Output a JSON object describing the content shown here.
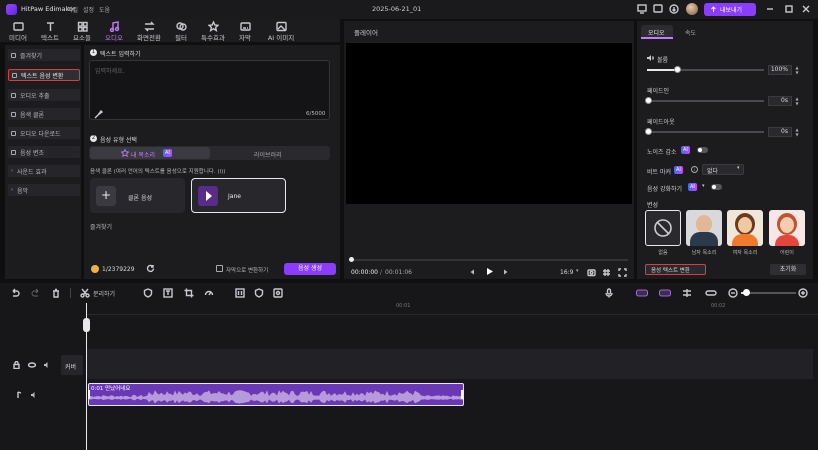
{
  "window": {
    "app_name": "HitPaw Edimakor",
    "menus": [
      "파일",
      "설정",
      "도움"
    ],
    "project_title": "2025-06-21_01",
    "export_label": "내보내기"
  },
  "toolbar": {
    "tools": [
      "미디어",
      "텍스트",
      "요소들",
      "오디오",
      "화면전환",
      "필터",
      "특수효과",
      "자막",
      "AI 이미지"
    ],
    "active_tool": "오디오"
  },
  "left_nav": {
    "items": [
      "즐겨찾기",
      "텍스트 음성 변환",
      "오디오 추출",
      "음색 클론",
      "오디오 다운로드",
      "음성 변조",
      "사운드 효과",
      "음악"
    ],
    "selected": "텍스트 음성 변환"
  },
  "tts": {
    "step1_label": "텍스트 입력하기",
    "placeholder": "입력하세요.",
    "char_count": "6/5000",
    "step2_label": "음성 유형 선택",
    "tab_my_voice": "내 목소리",
    "tab_library": "라이브러리",
    "clone_hint": "음색 클론 (여러 언어의 텍스트를 음성으로 지원합니다. (i))",
    "clone_button": "클론 음성",
    "voice_name": "Jane",
    "favorites_label": "즐겨찾기",
    "credits": "1/2379229",
    "subtitle_toggle": "자막으로 변환하기",
    "generate_button": "음성 생성"
  },
  "player": {
    "title": "플레이어",
    "current_time": "00:00:00",
    "total_time": "00:01:06",
    "ratio": "16:9"
  },
  "properties": {
    "tabs": [
      "오디오",
      "속도"
    ],
    "active_tab": "오디오",
    "volume_label": "볼륨",
    "volume_value": "100%",
    "volume_fraction": 0.25,
    "fade_in_label": "페이드인",
    "fade_in_value": "0s",
    "fade_out_label": "페이드아웃",
    "fade_out_value": "0s",
    "noise_label": "노이즈 감소",
    "beat_label": "비트 마커",
    "beat_select": "없다",
    "voice_enhance_label": "음성 강화하기",
    "change_voice_label": "변성",
    "voices": [
      "없음",
      "남자 목소리",
      "여자 목소리",
      "어린이"
    ],
    "tts_button": "음성 텍스트 변환",
    "reset_button": "초기화"
  },
  "timeline": {
    "split_label": "분리하기",
    "ruler": [
      "00:01",
      "00:02"
    ],
    "cover_label": "커버",
    "clip_label": "0:01 만났어네요"
  },
  "colors": {
    "accent": "#8a3cff",
    "accent_light": "#c47dff",
    "selection_red": "#e03b3b",
    "audio_clip": "#6a37b6",
    "waveform": "#b69ad9"
  }
}
